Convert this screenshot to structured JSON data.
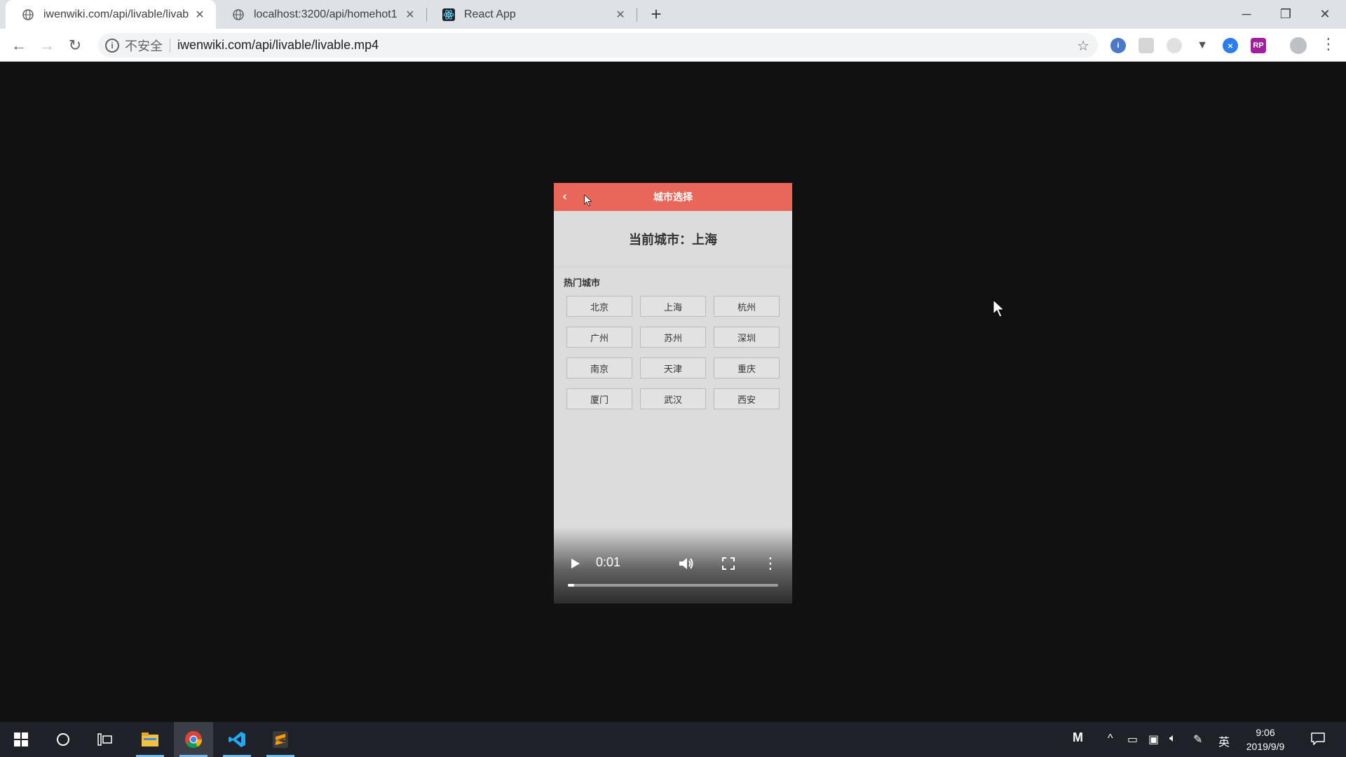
{
  "browser": {
    "tabs": [
      {
        "title": "iwenwiki.com/api/livable/livab",
        "favicon": "globe-icon",
        "active": true
      },
      {
        "title": "localhost:3200/api/homehot1",
        "favicon": "globe-icon",
        "active": false
      },
      {
        "title": "React App",
        "favicon": "react-icon",
        "active": false
      }
    ],
    "new_tab": "+",
    "window_controls": {
      "minimize": "─",
      "restore": "❐",
      "close": "✕"
    },
    "nav": {
      "back": "←",
      "forward": "→",
      "reload": "↻"
    },
    "address": {
      "security_label": "不安全",
      "url": "iwenwiki.com/api/livable/livable.mp4"
    },
    "bookmark_icon": "☆",
    "menu": "⋮"
  },
  "video_frame": {
    "header_title": "城市选择",
    "back_glyph": "‹",
    "current_city": "当前城市：上海",
    "hot_title": "热门城市",
    "cities": [
      "北京",
      "上海",
      "杭州",
      "广州",
      "苏州",
      "深圳",
      "南京",
      "天津",
      "重庆",
      "厦门",
      "武汉",
      "西安"
    ]
  },
  "video_controls": {
    "time": "0:01",
    "progress": 0.03
  },
  "taskbar": {
    "apps": [
      "start-icon",
      "cortana-icon",
      "task-view-icon",
      "file-explorer-icon",
      "chrome-icon",
      "vscode-icon",
      "sublime-icon"
    ],
    "tray": {
      "m_icon": "M",
      "ime": "英"
    },
    "clock_time": "9:06",
    "clock_date": "2019/9/9"
  },
  "colors": {
    "accent_header": "#e8675a",
    "video_bg": "#dcdcdc",
    "page_bg": "#111111"
  }
}
